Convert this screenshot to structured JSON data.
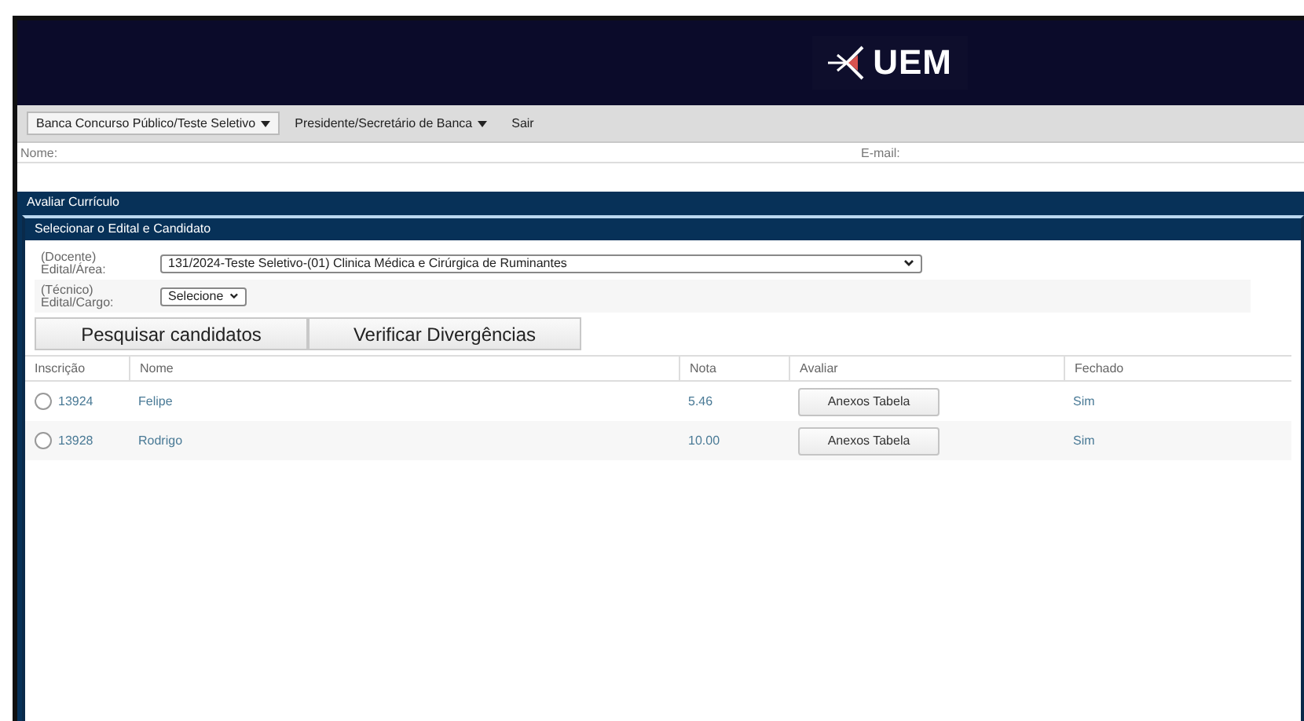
{
  "header": {
    "logo_text": "UEM"
  },
  "menu": [
    {
      "label": "Banca Concurso Público/Teste Seletivo",
      "dropdown": true,
      "selected": true
    },
    {
      "label": "Presidente/Secretário de Banca",
      "dropdown": true,
      "selected": false
    },
    {
      "label": "Sair",
      "dropdown": false,
      "selected": false
    }
  ],
  "user_info": {
    "name_label": "Nome:",
    "email_label": "E-mail:"
  },
  "panel": {
    "title": "Avaliar Currículo",
    "section": {
      "title": "Selecionar o Edital e Candidato",
      "fields": [
        {
          "label_top": "(Docente)",
          "label": "Edital/Área:",
          "value": "131/2024-Teste Seletivo-(01) Clinica Médica e Cirúrgica de Ruminantes",
          "kind": "wide"
        },
        {
          "label_top": "(Técnico)",
          "label": "Edital/Cargo:",
          "value": "Selecione",
          "kind": "narrow"
        }
      ],
      "buttons": [
        "Pesquisar candidatos",
        "Verificar Divergências"
      ],
      "table": {
        "columns": [
          "Inscrição",
          "Nome",
          "Nota",
          "Avaliar",
          "Fechado"
        ],
        "rows": [
          {
            "inscricao": "13924",
            "nome": "Felipe",
            "nota": "5.46",
            "avaliar": "Anexos Tabela",
            "fechado": "Sim",
            "selected": false
          },
          {
            "inscricao": "13928",
            "nome": "Rodrigo",
            "nota": "10.00",
            "avaliar": "Anexos Tabela",
            "fechado": "Sim",
            "selected": false
          }
        ]
      }
    }
  }
}
